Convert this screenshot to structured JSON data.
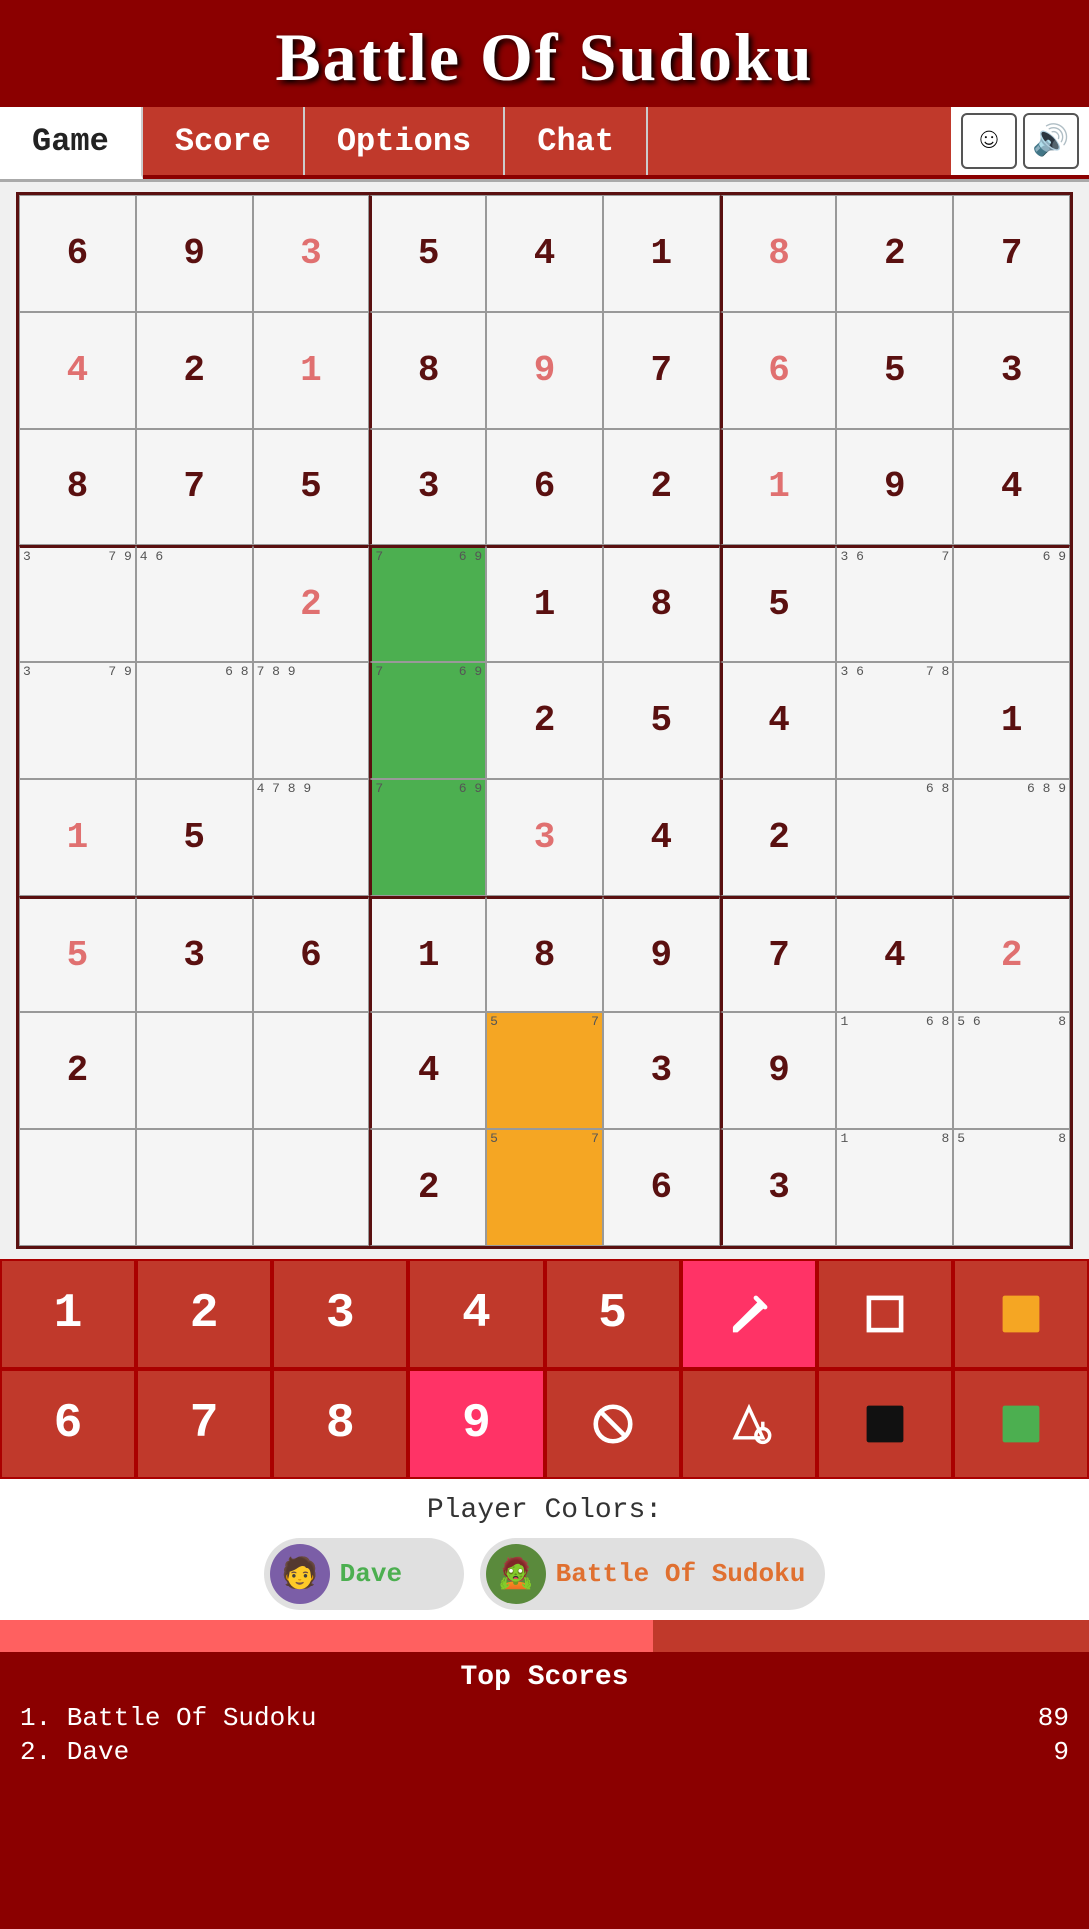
{
  "header": {
    "title": "Battle Of Sudoku"
  },
  "nav": {
    "tabs": [
      "Game",
      "Score",
      "Options",
      "Chat"
    ],
    "active_tab": "Game"
  },
  "grid": {
    "cells": [
      {
        "row": 0,
        "col": 0,
        "value": "6",
        "type": "dark"
      },
      {
        "row": 0,
        "col": 1,
        "value": "9",
        "type": "dark"
      },
      {
        "row": 0,
        "col": 2,
        "value": "3",
        "type": "light"
      },
      {
        "row": 0,
        "col": 3,
        "value": "5",
        "type": "dark"
      },
      {
        "row": 0,
        "col": 4,
        "value": "4",
        "type": "dark"
      },
      {
        "row": 0,
        "col": 5,
        "value": "1",
        "type": "dark"
      },
      {
        "row": 0,
        "col": 6,
        "value": "8",
        "type": "light"
      },
      {
        "row": 0,
        "col": 7,
        "value": "2",
        "type": "dark"
      },
      {
        "row": 0,
        "col": 8,
        "value": "7",
        "type": "dark"
      },
      {
        "row": 1,
        "col": 0,
        "value": "4",
        "type": "light"
      },
      {
        "row": 1,
        "col": 1,
        "value": "2",
        "type": "dark"
      },
      {
        "row": 1,
        "col": 2,
        "value": "1",
        "type": "light"
      },
      {
        "row": 1,
        "col": 3,
        "value": "8",
        "type": "dark"
      },
      {
        "row": 1,
        "col": 4,
        "value": "9",
        "type": "light"
      },
      {
        "row": 1,
        "col": 5,
        "value": "7",
        "type": "dark"
      },
      {
        "row": 1,
        "col": 6,
        "value": "6",
        "type": "light"
      },
      {
        "row": 1,
        "col": 7,
        "value": "5",
        "type": "dark"
      },
      {
        "row": 1,
        "col": 8,
        "value": "3",
        "type": "dark"
      },
      {
        "row": 2,
        "col": 0,
        "value": "8",
        "type": "dark"
      },
      {
        "row": 2,
        "col": 1,
        "value": "7",
        "type": "dark"
      },
      {
        "row": 2,
        "col": 2,
        "value": "5",
        "type": "dark"
      },
      {
        "row": 2,
        "col": 3,
        "value": "3",
        "type": "dark"
      },
      {
        "row": 2,
        "col": 4,
        "value": "6",
        "type": "dark"
      },
      {
        "row": 2,
        "col": 5,
        "value": "2",
        "type": "dark"
      },
      {
        "row": 2,
        "col": 6,
        "value": "1",
        "type": "light"
      },
      {
        "row": 2,
        "col": 7,
        "value": "9",
        "type": "dark"
      },
      {
        "row": 2,
        "col": 8,
        "value": "4",
        "type": "dark"
      },
      {
        "row": 3,
        "col": 0,
        "value": "",
        "type": "note",
        "notes_tl": "3",
        "notes_br": "7  9"
      },
      {
        "row": 3,
        "col": 1,
        "value": "",
        "type": "note",
        "notes_tl": "4  6"
      },
      {
        "row": 3,
        "col": 2,
        "value": "2",
        "type": "light"
      },
      {
        "row": 3,
        "col": 3,
        "value": "",
        "type": "green",
        "notes_br": "6 9",
        "notes_tl": "7"
      },
      {
        "row": 3,
        "col": 4,
        "value": "1",
        "type": "dark"
      },
      {
        "row": 3,
        "col": 5,
        "value": "8",
        "type": "dark"
      },
      {
        "row": 3,
        "col": 6,
        "value": "5",
        "type": "dark"
      },
      {
        "row": 3,
        "col": 7,
        "value": "",
        "type": "note",
        "notes_tl": "3  6",
        "notes_br": "7"
      },
      {
        "row": 3,
        "col": 8,
        "value": "",
        "type": "note",
        "notes_br": "6 9"
      },
      {
        "row": 4,
        "col": 0,
        "value": "",
        "type": "note",
        "notes_tl": "3",
        "notes_br": "7  9"
      },
      {
        "row": 4,
        "col": 1,
        "value": "",
        "type": "note",
        "notes_br": "6 8"
      },
      {
        "row": 4,
        "col": 2,
        "value": "",
        "type": "note",
        "notes_tl": "7 8 9"
      },
      {
        "row": 4,
        "col": 3,
        "value": "",
        "type": "green",
        "notes_tl": "7",
        "notes_br": "6 9"
      },
      {
        "row": 4,
        "col": 4,
        "value": "2",
        "type": "dark"
      },
      {
        "row": 4,
        "col": 5,
        "value": "5",
        "type": "dark"
      },
      {
        "row": 4,
        "col": 6,
        "value": "4",
        "type": "dark"
      },
      {
        "row": 4,
        "col": 7,
        "value": "",
        "type": "note",
        "notes_tl": "3  6",
        "notes_br": "7 8"
      },
      {
        "row": 4,
        "col": 8,
        "value": "1",
        "type": "dark"
      },
      {
        "row": 5,
        "col": 0,
        "value": "1",
        "type": "light"
      },
      {
        "row": 5,
        "col": 1,
        "value": "5",
        "type": "dark"
      },
      {
        "row": 5,
        "col": 2,
        "value": "",
        "type": "note",
        "notes_tl": "4 7 8 9"
      },
      {
        "row": 5,
        "col": 3,
        "value": "",
        "type": "green",
        "notes_tl": "7",
        "notes_br": "6 9"
      },
      {
        "row": 5,
        "col": 4,
        "value": "3",
        "type": "light"
      },
      {
        "row": 5,
        "col": 5,
        "value": "4",
        "type": "dark"
      },
      {
        "row": 5,
        "col": 6,
        "value": "2",
        "type": "dark"
      },
      {
        "row": 5,
        "col": 7,
        "value": "",
        "type": "note",
        "notes_br": "6 8"
      },
      {
        "row": 5,
        "col": 8,
        "value": "",
        "type": "note",
        "notes_br": "6 8 9"
      },
      {
        "row": 6,
        "col": 0,
        "value": "5",
        "type": "light"
      },
      {
        "row": 6,
        "col": 1,
        "value": "3",
        "type": "dark"
      },
      {
        "row": 6,
        "col": 2,
        "value": "6",
        "type": "dark"
      },
      {
        "row": 6,
        "col": 3,
        "value": "1",
        "type": "dark"
      },
      {
        "row": 6,
        "col": 4,
        "value": "8",
        "type": "dark"
      },
      {
        "row": 6,
        "col": 5,
        "value": "9",
        "type": "dark"
      },
      {
        "row": 6,
        "col": 6,
        "value": "7",
        "type": "dark"
      },
      {
        "row": 6,
        "col": 7,
        "value": "4",
        "type": "dark"
      },
      {
        "row": 6,
        "col": 8,
        "value": "2",
        "type": "light"
      },
      {
        "row": 7,
        "col": 0,
        "value": "2",
        "type": "dark"
      },
      {
        "row": 7,
        "col": 1,
        "value": "",
        "type": "empty"
      },
      {
        "row": 7,
        "col": 2,
        "value": "",
        "type": "empty"
      },
      {
        "row": 7,
        "col": 3,
        "value": "4",
        "type": "dark"
      },
      {
        "row": 7,
        "col": 4,
        "value": "",
        "type": "orange",
        "notes_tl": "5",
        "notes_br": "7"
      },
      {
        "row": 7,
        "col": 5,
        "value": "3",
        "type": "dark"
      },
      {
        "row": 7,
        "col": 6,
        "value": "9",
        "type": "dark"
      },
      {
        "row": 7,
        "col": 7,
        "value": "",
        "type": "note",
        "notes_tl": "1",
        "notes_br": "6 8"
      },
      {
        "row": 7,
        "col": 8,
        "value": "",
        "type": "note",
        "notes_tl": "5 6",
        "notes_br": "8"
      },
      {
        "row": 8,
        "col": 0,
        "value": "",
        "type": "empty"
      },
      {
        "row": 8,
        "col": 1,
        "value": "",
        "type": "empty"
      },
      {
        "row": 8,
        "col": 2,
        "value": "",
        "type": "empty"
      },
      {
        "row": 8,
        "col": 3,
        "value": "2",
        "type": "dark"
      },
      {
        "row": 8,
        "col": 4,
        "value": "",
        "type": "orange",
        "notes_tl": "5",
        "notes_br": "7"
      },
      {
        "row": 8,
        "col": 5,
        "value": "6",
        "type": "dark"
      },
      {
        "row": 8,
        "col": 6,
        "value": "3",
        "type": "dark"
      },
      {
        "row": 8,
        "col": 7,
        "value": "",
        "type": "note",
        "notes_tl": "1",
        "notes_br": "8"
      },
      {
        "row": 8,
        "col": 8,
        "value": "",
        "type": "note",
        "notes_tl": "5",
        "notes_br": "8"
      }
    ]
  },
  "numpad": {
    "row1": [
      {
        "label": "1",
        "active": false
      },
      {
        "label": "2",
        "active": false
      },
      {
        "label": "3",
        "active": false
      },
      {
        "label": "4",
        "active": false
      },
      {
        "label": "5",
        "active": false
      },
      {
        "label": "pencil",
        "active": true,
        "icon": true
      },
      {
        "label": "square",
        "active": false,
        "icon": true
      },
      {
        "label": "orange-square",
        "active": false,
        "icon": true,
        "color": "#f5a623"
      }
    ],
    "row2": [
      {
        "label": "6",
        "active": false
      },
      {
        "label": "7",
        "active": false
      },
      {
        "label": "8",
        "active": false
      },
      {
        "label": "9",
        "active": true
      },
      {
        "label": "ban",
        "active": false,
        "icon": true
      },
      {
        "label": "fill",
        "active": false,
        "icon": true
      },
      {
        "label": "black-square",
        "active": false,
        "icon": true,
        "color": "#000"
      },
      {
        "label": "green-square",
        "active": false,
        "icon": true,
        "color": "#4caf50"
      }
    ]
  },
  "player_colors": {
    "label": "Player Colors:",
    "players": [
      {
        "name": "Dave",
        "color_class": "green",
        "avatar": "🧑"
      },
      {
        "name": "Battle Of Sudoku",
        "color_class": "orange",
        "avatar": "🧟"
      }
    ]
  },
  "scores": {
    "title": "Top Scores",
    "rows": [
      {
        "rank": "1.",
        "name": "Battle Of Sudoku",
        "score": "89"
      },
      {
        "rank": "2.",
        "name": "Dave",
        "score": "9"
      }
    ]
  }
}
